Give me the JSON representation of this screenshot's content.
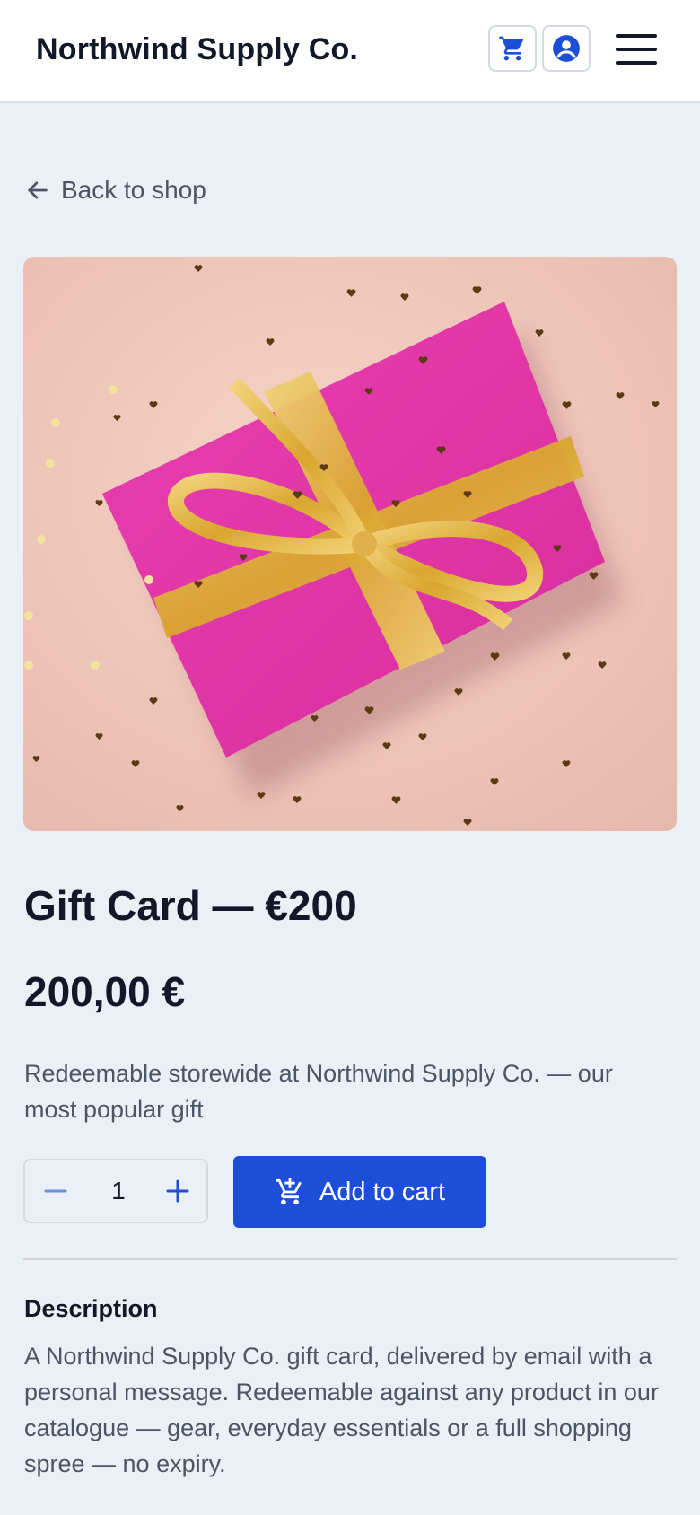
{
  "header": {
    "brand": "Northwind Supply Co.",
    "icons": {
      "cart": "cart-icon",
      "account": "account-circle-icon",
      "menu": "hamburger-menu-icon"
    }
  },
  "nav": {
    "back_label": "Back to shop"
  },
  "product": {
    "title": "Gift Card — €200",
    "price": "200,00 €",
    "subtitle": "Redeemable storewide at Northwind Supply Co. — our most popular gift",
    "image_alt": "Pink gift box with gold ribbon and confetti hearts",
    "quantity": "1"
  },
  "actions": {
    "add_to_cart": "Add to cart"
  },
  "description": {
    "heading": "Description",
    "body": "A Northwind Supply Co. gift card, delivered by email with a personal message. Redeemable against any product in our catalogue — gear, everyday essentials or a full shopping spree — no expiry."
  },
  "colors": {
    "accent": "#1d4ed8",
    "background": "#ebeff6",
    "text": "#111827",
    "muted": "#4b5563"
  }
}
